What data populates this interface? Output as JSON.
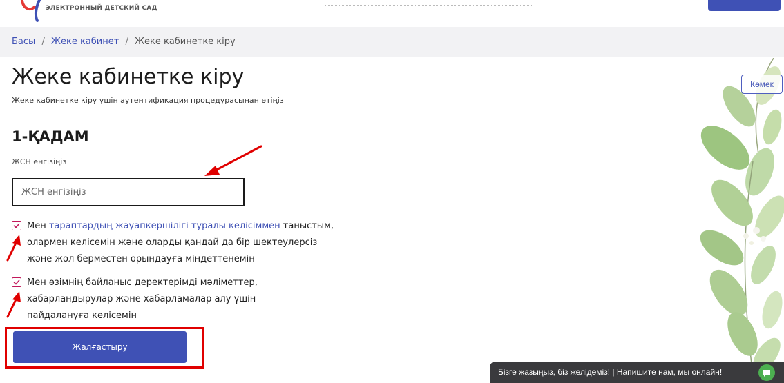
{
  "header": {
    "logo_subtitle": "ЭЛЕКТРОННЫЙ ДЕТСКИЙ САД"
  },
  "breadcrumb": {
    "home": "Басы",
    "separator": "/",
    "cabinet": "Жеке кабинет",
    "current": "Жеке кабинетке кіру"
  },
  "page": {
    "title": "Жеке кабинетке кіру",
    "subtitle": "Жеке кабинетке кіру үшін аутентификация процедурасынан өтіңіз",
    "help_label": "Көмек"
  },
  "step": {
    "title": "1-ҚАДАМ",
    "iin_label": "ЖСН енгізіңіз",
    "iin_placeholder": "ЖСН енгізіңіз",
    "iin_value": ""
  },
  "agreements": {
    "first": {
      "checked": true,
      "prefix": "Мен ",
      "link": "тараптардың жауапкершілігі туралы келісіммен",
      "suffix": " таныстым, олармен келісемін және оларды қандай да бір шектеулерсіз және жол берместен орындауға міндеттенемін"
    },
    "second": {
      "checked": true,
      "text": "Мен өзімнің байланыс деректерімді мәліметтер, хабарландырулар және хабарламалар алу үшін пайдалануға келісемін"
    }
  },
  "actions": {
    "continue_label": "Жалғастыру"
  },
  "chat": {
    "text": "Бізге жазыңыз, біз желідеміз! | Напишите нам, мы онлайн!"
  },
  "colors": {
    "accent": "#3f51b5",
    "checkbox": "#c2185b",
    "annotation": "#e00000",
    "chat_bg": "#3a3a3d",
    "chat_icon": "#4caf50"
  },
  "icons": {
    "logo": "logo-mark-icon",
    "checkbox": "check-icon",
    "chat": "chat-bubble-icon"
  }
}
